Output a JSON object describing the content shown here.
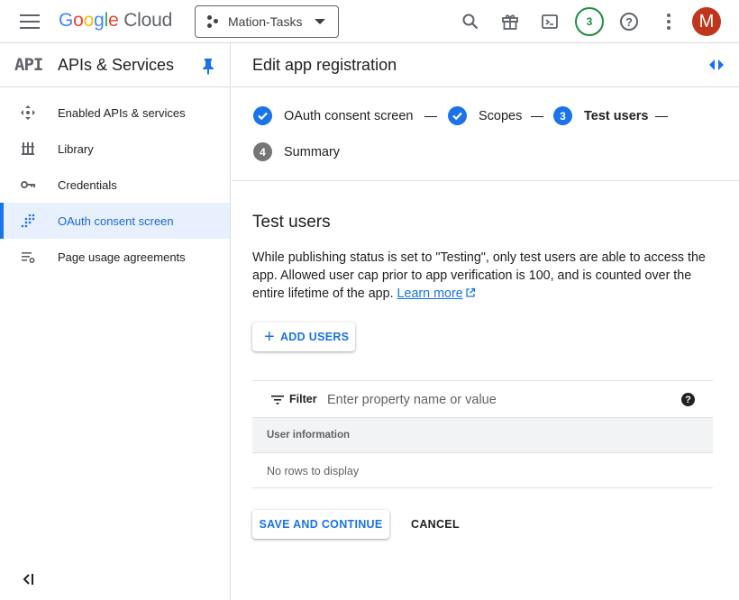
{
  "topbar": {
    "logo_letters": [
      "G",
      "o",
      "o",
      "g",
      "l",
      "e"
    ],
    "logo_colors": [
      "#4285f4",
      "#ea4335",
      "#fbbc05",
      "#4285f4",
      "#34a853",
      "#ea4335"
    ],
    "logo_suffix": "Cloud",
    "project_name": "Mation-Tasks",
    "notification_count": "3",
    "avatar_letter": "M",
    "icons": [
      "menu-icon",
      "search-icon",
      "gift-icon",
      "terminal-icon",
      "help-icon",
      "more-vert-icon"
    ]
  },
  "sidebar": {
    "glyph": "API",
    "title": "APIs & Services",
    "items": [
      {
        "label": "Enabled APIs & services",
        "icon": "move-arrows-icon",
        "active": false
      },
      {
        "label": "Library",
        "icon": "library-icon",
        "active": false
      },
      {
        "label": "Credentials",
        "icon": "key-icon",
        "active": false
      },
      {
        "label": "OAuth consent screen",
        "icon": "dot-grid-icon",
        "active": true
      },
      {
        "label": "Page usage agreements",
        "icon": "settings-list-icon",
        "active": false
      }
    ]
  },
  "main": {
    "title": "Edit app registration",
    "steps": [
      {
        "label": "OAuth consent screen",
        "state": "done"
      },
      {
        "label": "Scopes",
        "state": "done"
      },
      {
        "number": "3",
        "label": "Test users",
        "state": "current"
      },
      {
        "number": "4",
        "label": "Summary",
        "state": "upcoming"
      }
    ],
    "section_title": "Test users",
    "description": "While publishing status is set to \"Testing\", only test users are able to access the app. Allowed user cap prior to app verification is 100, and is counted over the entire lifetime of the app.",
    "learn_more": "Learn more",
    "add_users_label": "ADD USERS",
    "filter": {
      "label": "Filter",
      "placeholder": "Enter property name or value",
      "help": "?"
    },
    "table": {
      "column_header": "User information",
      "empty_text": "No rows to display"
    },
    "save_label": "SAVE AND CONTINUE",
    "cancel_label": "CANCEL"
  },
  "colors": {
    "accent": "#1a73e8",
    "active_bg": "#e8f0fe",
    "avatar": "#c0361c",
    "badge": "#1e8e3e"
  }
}
